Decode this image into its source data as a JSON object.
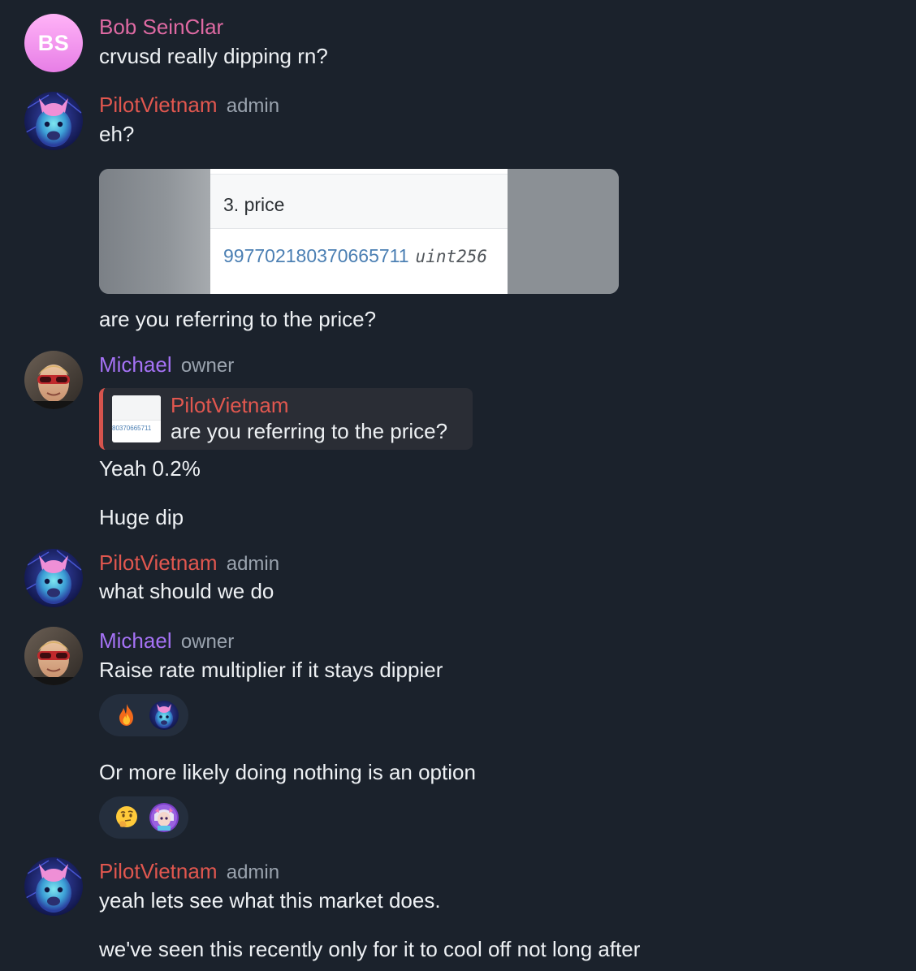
{
  "messages": [
    {
      "sender": "Bob SeinClar",
      "initials": "BS",
      "text": "crvusd really dipping rn?"
    },
    {
      "sender": "PilotVietnam",
      "role": "admin",
      "text": "eh?",
      "photo": {
        "label": "3. price",
        "value": "997702180370665711",
        "type": "uint256"
      },
      "caption": "are you referring to the price?"
    },
    {
      "sender": "Michael",
      "role": "owner",
      "reply": {
        "sender": "PilotVietnam",
        "text": "are you referring to the price?",
        "thumb_text": "80370665711"
      },
      "texts": [
        "Yeah 0.2%",
        "Huge dip"
      ]
    },
    {
      "sender": "PilotVietnam",
      "role": "admin",
      "text": "what should we do"
    },
    {
      "sender": "Michael",
      "role": "owner",
      "texts": [
        "Raise rate multiplier if it stays dippier",
        "Or more likely doing nothing is an option"
      ],
      "reactions": [
        {
          "emoji": "fire-emoji",
          "reactor": "pilotvietnam-avatar"
        },
        {
          "emoji": "thinking-face-emoji",
          "reactor": "anime-avatar"
        }
      ]
    },
    {
      "sender": "PilotVietnam",
      "role": "admin",
      "texts": [
        "yeah lets see what this market does.",
        "we've seen this recently only for it to cool off not long after"
      ]
    }
  ],
  "colors": {
    "background": "#1b222c",
    "sender_bob": "#df6aa3",
    "sender_pilot": "#e1574f",
    "sender_michael": "#a572f5",
    "role": "#9aa3ae"
  }
}
